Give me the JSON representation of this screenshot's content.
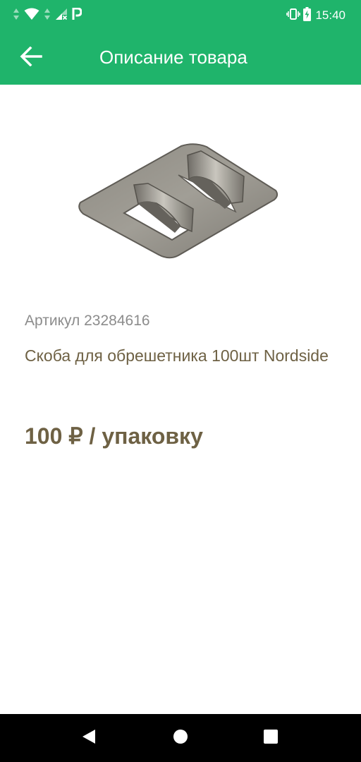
{
  "status_bar": {
    "time": "15:40",
    "icons": [
      "data-arrows-icon",
      "wifi-icon",
      "data-arrows-icon",
      "cell-signal-no-sim-icon",
      "parking-app-icon",
      "vibrate-icon",
      "battery-charging-icon"
    ],
    "color": "#1fb46b"
  },
  "app_bar": {
    "title": "Описание товара",
    "back_icon": "arrow-left-icon",
    "color": "#1fb46b"
  },
  "product": {
    "image": "metal-clip-bracket-photo",
    "article": "Артикул 23284616",
    "name": "Скоба для обрешетника 100шт Nordside",
    "price": "100 ₽ / упаковку",
    "text_color": "#6e6144"
  },
  "nav_bar": {
    "icons": [
      "back-triangle-icon",
      "home-circle-icon",
      "recents-square-icon"
    ]
  }
}
